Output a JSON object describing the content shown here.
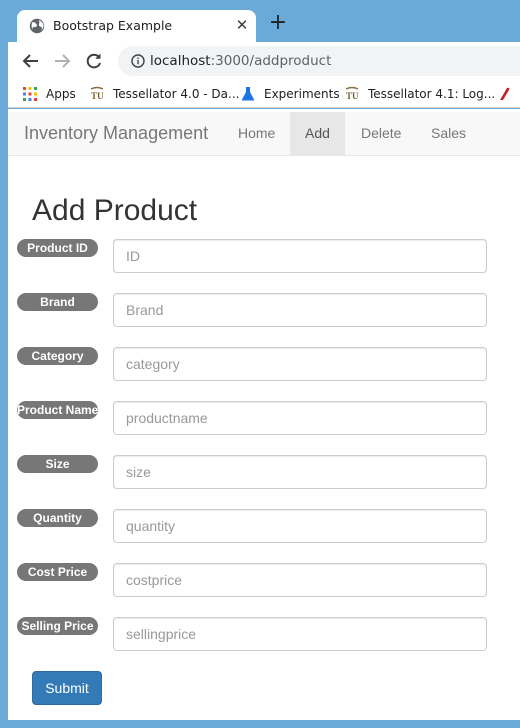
{
  "browser": {
    "tab": {
      "title": "Bootstrap Example",
      "close_glyph": "✕"
    },
    "new_tab_glyph": "+",
    "url_host": "localhost",
    "url_path": ":3000/addproduct",
    "bookmarks": [
      {
        "label": "Apps",
        "icon": "apps-grid-icon"
      },
      {
        "label": "Tessellator 4.0 - Da...",
        "icon": "tessellator-icon"
      },
      {
        "label": "Experiments",
        "icon": "flask-icon"
      },
      {
        "label": "Tessellator 4.1: Log...",
        "icon": "tessellator-icon"
      }
    ],
    "frame_color": "#6aaad8"
  },
  "navbar": {
    "brand": "Inventory Management",
    "items": [
      {
        "label": "Home",
        "active": false
      },
      {
        "label": "Add",
        "active": true
      },
      {
        "label": "Delete",
        "active": false
      },
      {
        "label": "Sales",
        "active": false
      }
    ]
  },
  "form": {
    "heading": "Add Product",
    "fields": [
      {
        "label": "Product ID",
        "placeholder": "ID",
        "value": ""
      },
      {
        "label": "Brand",
        "placeholder": "Brand",
        "value": ""
      },
      {
        "label": "Category",
        "placeholder": "category",
        "value": ""
      },
      {
        "label": "Product Name",
        "placeholder": "productname",
        "value": ""
      },
      {
        "label": "Size",
        "placeholder": "size",
        "value": ""
      },
      {
        "label": "Quantity",
        "placeholder": "quantity",
        "value": ""
      },
      {
        "label": "Cost Price",
        "placeholder": "costprice",
        "value": ""
      },
      {
        "label": "Selling Price",
        "placeholder": "sellingprice",
        "value": ""
      }
    ],
    "submit_label": "Submit",
    "submit_color": "#337ab7"
  }
}
